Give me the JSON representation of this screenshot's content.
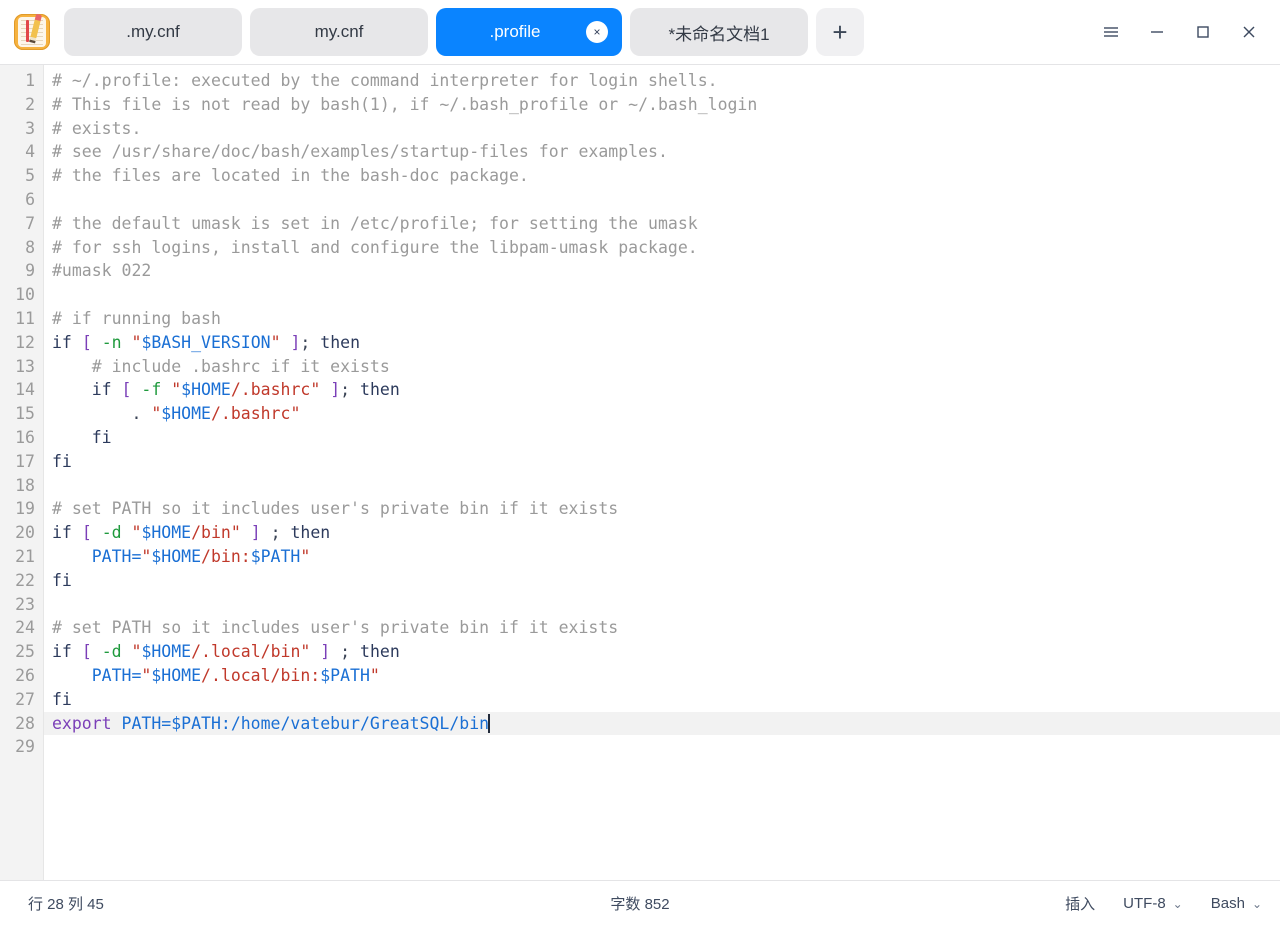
{
  "window": {
    "app_icon": "notepad-pencil-icon",
    "controls": {
      "menu": "hamburger-menu-icon",
      "minimize": "minimize-icon",
      "maximize": "maximize-icon",
      "close": "close-icon"
    }
  },
  "tabs": {
    "items": [
      {
        "label": ".my.cnf",
        "active": false,
        "modified": false
      },
      {
        "label": "my.cnf",
        "active": false,
        "modified": false
      },
      {
        "label": ".profile",
        "active": true,
        "modified": false,
        "close": "×"
      },
      {
        "label": "*未命名文档1",
        "active": false,
        "modified": true
      }
    ],
    "new_tab_label": "+"
  },
  "editor": {
    "language": "Bash",
    "active_line": 28,
    "lines": [
      {
        "n": 1,
        "tokens": [
          {
            "t": "# ~/.profile: executed by the command interpreter for login shells.",
            "c": "c-comment"
          }
        ]
      },
      {
        "n": 2,
        "tokens": [
          {
            "t": "# This file is not read by bash(1), if ~/.bash_profile or ~/.bash_login",
            "c": "c-comment"
          }
        ]
      },
      {
        "n": 3,
        "tokens": [
          {
            "t": "# exists.",
            "c": "c-comment"
          }
        ]
      },
      {
        "n": 4,
        "tokens": [
          {
            "t": "# see /usr/share/doc/bash/examples/startup-files for examples.",
            "c": "c-comment"
          }
        ]
      },
      {
        "n": 5,
        "tokens": [
          {
            "t": "# the files are located in the bash-doc package.",
            "c": "c-comment"
          }
        ]
      },
      {
        "n": 6,
        "tokens": []
      },
      {
        "n": 7,
        "tokens": [
          {
            "t": "# the default umask is set in /etc/profile; for setting the umask",
            "c": "c-comment"
          }
        ]
      },
      {
        "n": 8,
        "tokens": [
          {
            "t": "# for ssh logins, install and configure the libpam-umask package.",
            "c": "c-comment"
          }
        ]
      },
      {
        "n": 9,
        "tokens": [
          {
            "t": "#umask 022",
            "c": "c-comment"
          }
        ]
      },
      {
        "n": 10,
        "tokens": []
      },
      {
        "n": 11,
        "tokens": [
          {
            "t": "# if running bash",
            "c": "c-comment"
          }
        ]
      },
      {
        "n": 12,
        "tokens": [
          {
            "t": "if ",
            "c": "c-kw"
          },
          {
            "t": "[",
            "c": "c-brk"
          },
          {
            "t": " ",
            "c": "c-plain"
          },
          {
            "t": "-n",
            "c": "c-flag"
          },
          {
            "t": " ",
            "c": "c-plain"
          },
          {
            "t": "\"",
            "c": "c-str"
          },
          {
            "t": "$BASH_VERSION",
            "c": "c-var"
          },
          {
            "t": "\"",
            "c": "c-str"
          },
          {
            "t": " ",
            "c": "c-plain"
          },
          {
            "t": "]",
            "c": "c-brk"
          },
          {
            "t": "; ",
            "c": "c-plain"
          },
          {
            "t": "then",
            "c": "c-kw"
          }
        ]
      },
      {
        "n": 13,
        "tokens": [
          {
            "t": "    # include .bashrc if it exists",
            "c": "c-comment"
          }
        ]
      },
      {
        "n": 14,
        "tokens": [
          {
            "t": "    if ",
            "c": "c-kw"
          },
          {
            "t": "[",
            "c": "c-brk"
          },
          {
            "t": " ",
            "c": "c-plain"
          },
          {
            "t": "-f",
            "c": "c-flag"
          },
          {
            "t": " ",
            "c": "c-plain"
          },
          {
            "t": "\"",
            "c": "c-str"
          },
          {
            "t": "$HOME",
            "c": "c-var"
          },
          {
            "t": "/.bashrc",
            "c": "c-str"
          },
          {
            "t": "\"",
            "c": "c-str"
          },
          {
            "t": " ",
            "c": "c-plain"
          },
          {
            "t": "]",
            "c": "c-brk"
          },
          {
            "t": "; ",
            "c": "c-plain"
          },
          {
            "t": "then",
            "c": "c-kw"
          }
        ]
      },
      {
        "n": 15,
        "tokens": [
          {
            "t": "        . ",
            "c": "c-plain"
          },
          {
            "t": "\"",
            "c": "c-str"
          },
          {
            "t": "$HOME",
            "c": "c-var"
          },
          {
            "t": "/.bashrc",
            "c": "c-str"
          },
          {
            "t": "\"",
            "c": "c-str"
          }
        ]
      },
      {
        "n": 16,
        "tokens": [
          {
            "t": "    fi",
            "c": "c-kw"
          }
        ]
      },
      {
        "n": 17,
        "tokens": [
          {
            "t": "fi",
            "c": "c-kw"
          }
        ]
      },
      {
        "n": 18,
        "tokens": []
      },
      {
        "n": 19,
        "tokens": [
          {
            "t": "# set PATH so it includes user's private bin if it exists",
            "c": "c-comment"
          }
        ]
      },
      {
        "n": 20,
        "tokens": [
          {
            "t": "if ",
            "c": "c-kw"
          },
          {
            "t": "[",
            "c": "c-brk"
          },
          {
            "t": " ",
            "c": "c-plain"
          },
          {
            "t": "-d",
            "c": "c-flag"
          },
          {
            "t": " ",
            "c": "c-plain"
          },
          {
            "t": "\"",
            "c": "c-str"
          },
          {
            "t": "$HOME",
            "c": "c-var"
          },
          {
            "t": "/bin",
            "c": "c-str"
          },
          {
            "t": "\"",
            "c": "c-str"
          },
          {
            "t": " ",
            "c": "c-plain"
          },
          {
            "t": "]",
            "c": "c-brk"
          },
          {
            "t": " ; ",
            "c": "c-plain"
          },
          {
            "t": "then",
            "c": "c-kw"
          }
        ]
      },
      {
        "n": 21,
        "tokens": [
          {
            "t": "    PATH=",
            "c": "c-var"
          },
          {
            "t": "\"",
            "c": "c-str"
          },
          {
            "t": "$HOME",
            "c": "c-var"
          },
          {
            "t": "/bin:",
            "c": "c-str"
          },
          {
            "t": "$PATH",
            "c": "c-var"
          },
          {
            "t": "\"",
            "c": "c-str"
          }
        ]
      },
      {
        "n": 22,
        "tokens": [
          {
            "t": "fi",
            "c": "c-kw"
          }
        ]
      },
      {
        "n": 23,
        "tokens": []
      },
      {
        "n": 24,
        "tokens": [
          {
            "t": "# set PATH so it includes user's private bin if it exists",
            "c": "c-comment"
          }
        ]
      },
      {
        "n": 25,
        "tokens": [
          {
            "t": "if ",
            "c": "c-kw"
          },
          {
            "t": "[",
            "c": "c-brk"
          },
          {
            "t": " ",
            "c": "c-plain"
          },
          {
            "t": "-d",
            "c": "c-flag"
          },
          {
            "t": " ",
            "c": "c-plain"
          },
          {
            "t": "\"",
            "c": "c-str"
          },
          {
            "t": "$HOME",
            "c": "c-var"
          },
          {
            "t": "/.local/bin",
            "c": "c-str"
          },
          {
            "t": "\"",
            "c": "c-str"
          },
          {
            "t": " ",
            "c": "c-plain"
          },
          {
            "t": "]",
            "c": "c-brk"
          },
          {
            "t": " ; ",
            "c": "c-plain"
          },
          {
            "t": "then",
            "c": "c-kw"
          }
        ]
      },
      {
        "n": 26,
        "tokens": [
          {
            "t": "    PATH=",
            "c": "c-var"
          },
          {
            "t": "\"",
            "c": "c-str"
          },
          {
            "t": "$HOME",
            "c": "c-var"
          },
          {
            "t": "/.local/bin:",
            "c": "c-str"
          },
          {
            "t": "$PATH",
            "c": "c-var"
          },
          {
            "t": "\"",
            "c": "c-str"
          }
        ]
      },
      {
        "n": 27,
        "tokens": [
          {
            "t": "fi",
            "c": "c-kw"
          }
        ]
      },
      {
        "n": 28,
        "tokens": [
          {
            "t": "export ",
            "c": "c-export"
          },
          {
            "t": "PATH=$PATH:/home/vatebur/GreatSQL/bin",
            "c": "c-var"
          }
        ],
        "caret": true
      },
      {
        "n": 29,
        "tokens": []
      }
    ]
  },
  "statusbar": {
    "position": "行 28 列 45",
    "word_count": "字数 852",
    "insert_mode": "插入",
    "encoding": "UTF-8",
    "language": "Bash",
    "chevron": "⌄"
  },
  "colors": {
    "accent": "#0a84ff",
    "tab_inactive": "#e7e7e9",
    "gutter": "#f3f3f3",
    "current_line": "#f2f2f2",
    "comment": "#9a9a9a",
    "keyword": "#2c3a5c",
    "string": "#c0392b",
    "variable": "#1a6fd4",
    "bracket": "#7b3fb8",
    "flag": "#1f9a3d"
  }
}
